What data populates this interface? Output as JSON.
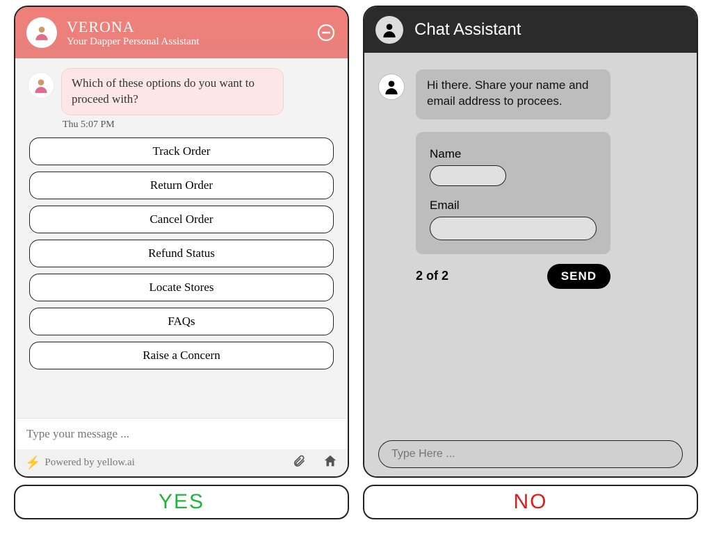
{
  "left": {
    "header": {
      "name": "VERONA",
      "subtitle": "Your Dapper Personal Assistant"
    },
    "message": "Which of these options do you want to proceed with?",
    "timestamp": "Thu 5:07 PM",
    "options": [
      "Track Order",
      "Return Order",
      "Cancel Order",
      "Refund Status",
      "Locate Stores",
      "FAQs",
      "Raise a Concern"
    ],
    "input_placeholder": "Type your message ...",
    "powered_by": "Powered by yellow.ai"
  },
  "right": {
    "header": {
      "title": "Chat Assistant"
    },
    "message": "Hi there. Share your name and email address to procees.",
    "form": {
      "name_label": "Name",
      "email_label": "Email"
    },
    "counter": "2 of 2",
    "send_label": "SEND",
    "input_placeholder": "Type Here ..."
  },
  "labels": {
    "yes": "YES",
    "no": "NO"
  }
}
